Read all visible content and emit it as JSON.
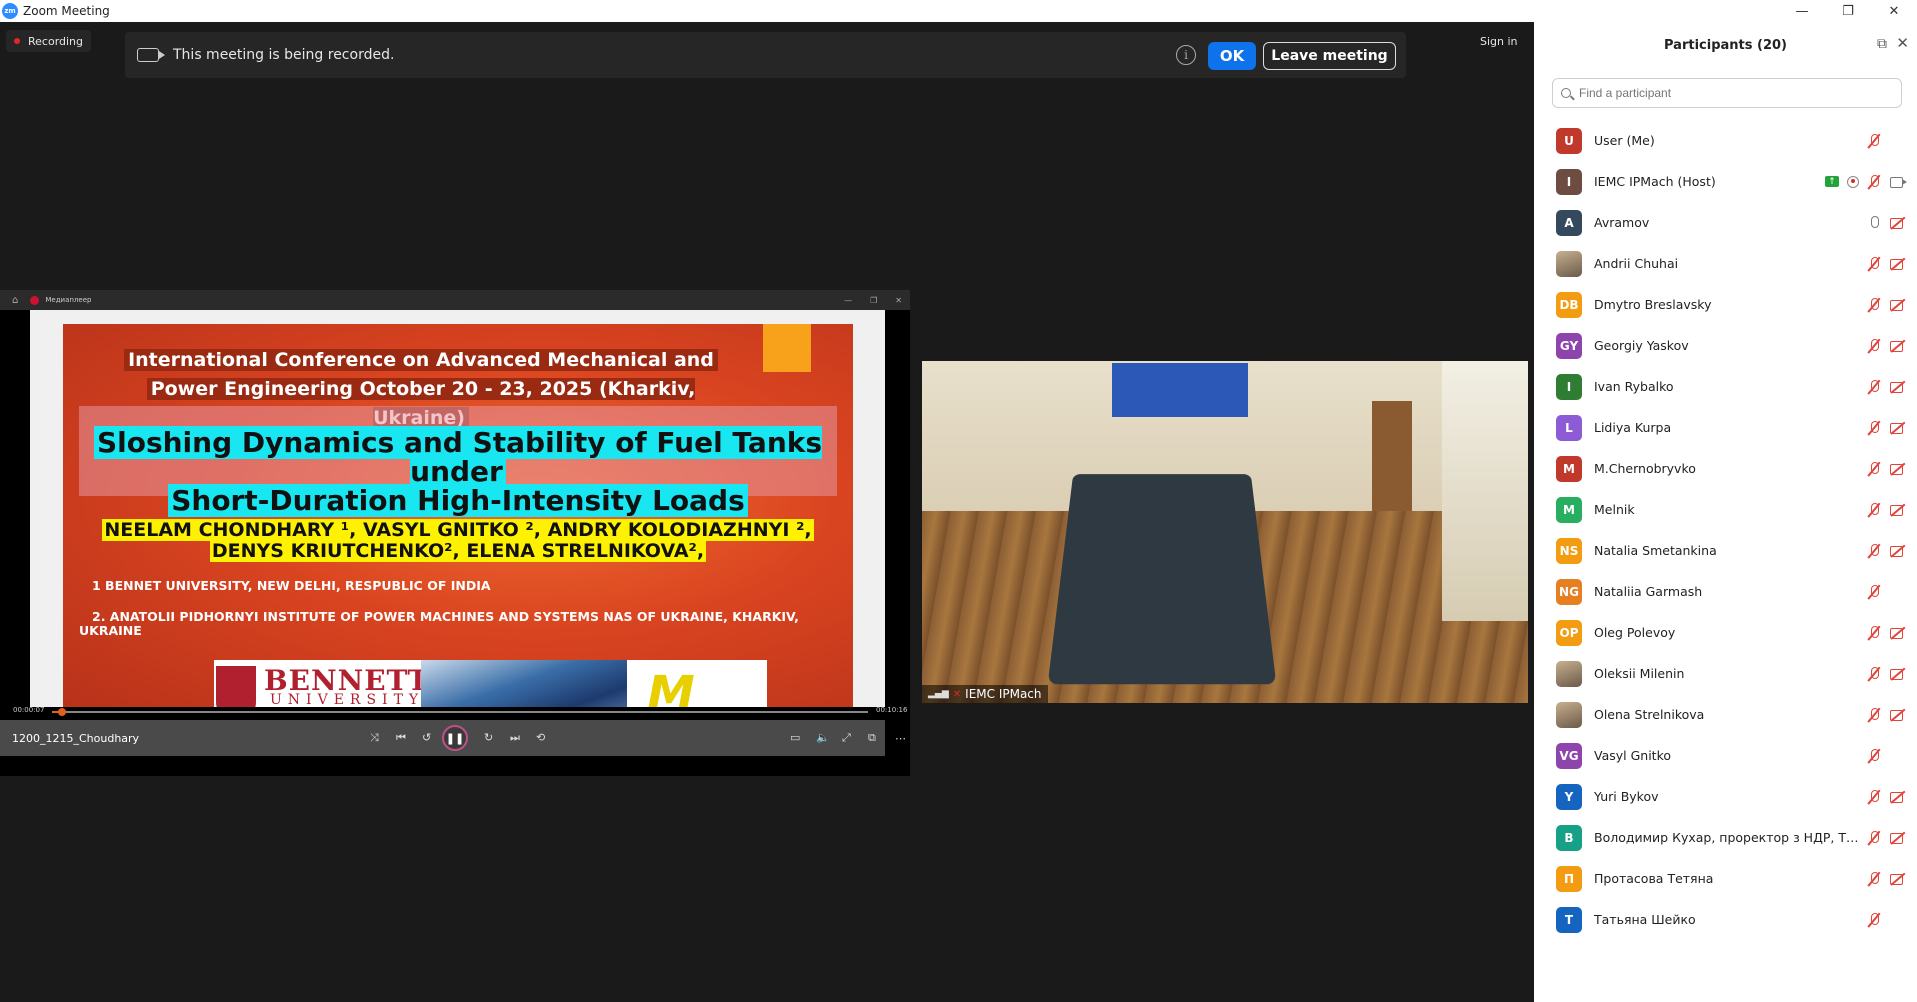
{
  "window": {
    "title": "Zoom Meeting",
    "app_logo": "zm"
  },
  "window_controls": {
    "minimize": "—",
    "restore": "❐",
    "close": "✕"
  },
  "recording": {
    "pill_label": "Recording",
    "banner_message": "This meeting is being recorded.",
    "info_symbol": "i",
    "ok_label": "OK",
    "leave_label": "Leave meeting"
  },
  "header": {
    "sign_in": "Sign in"
  },
  "media_player": {
    "title": "Медиаплеер",
    "file_name": "1200_1215_Choudhary",
    "time_elapsed": "00:00:07",
    "time_total": "00:10:16",
    "progress": 0.012
  },
  "slide": {
    "conf_title_line1": "International Conference on Advanced Mechanical and",
    "conf_title_line2": "Power Engineering October 20 - 23, 2025 (Kharkiv, Ukraine)",
    "paper_title_line1": "Sloshing Dynamics and Stability of Fuel Tanks under",
    "paper_title_line2": "Short-Duration High-Intensity Loads",
    "authors_line1": "NEELAM CHONDHARY ¹, VASYL GNITKO ², ANDRY KOLODIAZHNYI ²,",
    "authors_line2": "DENYS KRIUTCHENKO², ELENA STRELNIKOVA²,",
    "affil1": "1   BENNET UNIVERSITY, NEW DELHI, RESPUBLIC OF INDIA",
    "affil2_line1": "2.  ANATOLII PIDHORNYI INSTITUTE OF POWER MACHINES AND SYSTEMS NAS OF UKRAINE, KHARKIV,",
    "affil2_line2": "UKRAINE",
    "logo_bennett": "BENNETT",
    "logo_university": "UNIVERSITY"
  },
  "video": {
    "participant_label": "IEMC IPMach"
  },
  "participants_panel": {
    "title": "Participants (20)",
    "search_placeholder": "Find a participant",
    "participants": [
      {
        "initials": "U",
        "color": "#c0392b",
        "name": "User (Me)",
        "mic": "off",
        "video": "none"
      },
      {
        "initials": "I",
        "color": "#6d4c41",
        "name": "IEMC IPMach (Host)",
        "mic": "off",
        "video": "on",
        "sharing": true,
        "recording": true
      },
      {
        "initials": "A",
        "color": "#34495e",
        "name": "Avramov",
        "mic": "on",
        "video": "off"
      },
      {
        "initials": "",
        "color": "#8a7050",
        "name": "Andrii Chuhai",
        "mic": "off",
        "video": "off",
        "photo": true
      },
      {
        "initials": "DB",
        "color": "#f39c12",
        "name": "Dmytro Breslavsky",
        "mic": "off",
        "video": "off"
      },
      {
        "initials": "GY",
        "color": "#8e44ad",
        "name": "Georgiy Yaskov",
        "mic": "off",
        "video": "off"
      },
      {
        "initials": "I",
        "color": "#2e7d32",
        "name": "Ivan Rybalko",
        "mic": "off",
        "video": "off"
      },
      {
        "initials": "L",
        "color": "#8e5bd6",
        "name": "Lidiya Kurpa",
        "mic": "off",
        "video": "off"
      },
      {
        "initials": "M",
        "color": "#c0392b",
        "name": "M.Chernobryvko",
        "mic": "off",
        "video": "off"
      },
      {
        "initials": "M",
        "color": "#27ae60",
        "name": "Melnik",
        "mic": "off",
        "video": "off"
      },
      {
        "initials": "NS",
        "color": "#f39c12",
        "name": "Natalia Smetankina",
        "mic": "off",
        "video": "off"
      },
      {
        "initials": "NG",
        "color": "#e67e22",
        "name": "Nataliia Garmash",
        "mic": "off",
        "video": "none"
      },
      {
        "initials": "OP",
        "color": "#f39c12",
        "name": "Oleg Polevoy",
        "mic": "off",
        "video": "off"
      },
      {
        "initials": "",
        "color": "#7a6a5a",
        "name": "Oleksii Milenin",
        "mic": "off",
        "video": "off",
        "photo": true
      },
      {
        "initials": "",
        "color": "#5a4a3a",
        "name": "Olena Strelnikova",
        "mic": "off",
        "video": "off",
        "photo": true
      },
      {
        "initials": "VG",
        "color": "#8e44ad",
        "name": "Vasyl Gnitko",
        "mic": "off",
        "video": "none"
      },
      {
        "initials": "Y",
        "color": "#1565c0",
        "name": "Yuri Bykov",
        "mic": "off",
        "video": "off"
      },
      {
        "initials": "В",
        "color": "#16a085",
        "name": "Володимир Кухар, проректор з НДР, ТОВ ...",
        "mic": "off",
        "video": "off"
      },
      {
        "initials": "П",
        "color": "#f39c12",
        "name": "Протасова Тетяна",
        "mic": "off",
        "video": "off"
      },
      {
        "initials": "Т",
        "color": "#1565c0",
        "name": "Татьяна Шейко",
        "mic": "off",
        "video": "none"
      }
    ]
  }
}
